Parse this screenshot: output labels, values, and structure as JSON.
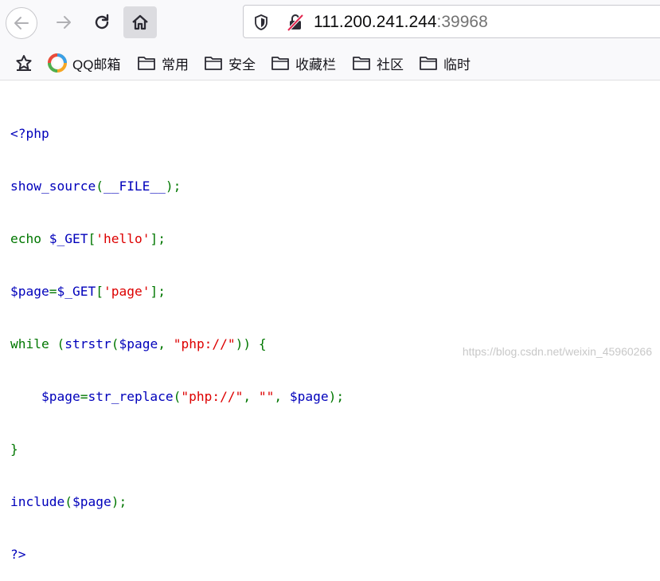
{
  "browser": {
    "url_host": "111.200.241.244",
    "url_port": ":39968"
  },
  "bookmarks": [
    {
      "label": "QQ邮箱",
      "icon": "qq-mail-icon"
    },
    {
      "label": "常用",
      "icon": "folder-icon"
    },
    {
      "label": "安全",
      "icon": "folder-icon"
    },
    {
      "label": "收藏栏",
      "icon": "folder-icon"
    },
    {
      "label": "社区",
      "icon": "folder-icon"
    },
    {
      "label": "临时",
      "icon": "folder-icon"
    }
  ],
  "code": {
    "l1": "<?php",
    "l2a": "show_source",
    "l2b": "(",
    "l2c": "__FILE__",
    "l2d": ");",
    "l3a": "echo ",
    "l3b": "$_GET",
    "l3c": "[",
    "l3d": "'hello'",
    "l3e": "];",
    "l4a": "$page",
    "l4b": "=",
    "l4c": "$_GET",
    "l4d": "[",
    "l4e": "'page'",
    "l4f": "];",
    "l5a": "while (",
    "l5b": "strstr",
    "l5c": "(",
    "l5d": "$page",
    "l5e": ", ",
    "l5f": "\"php://\"",
    "l5g": ")) {",
    "l6a": "    ",
    "l6b": "$page",
    "l6c": "=",
    "l6d": "str_replace",
    "l6e": "(",
    "l6f": "\"php://\"",
    "l6g": ", ",
    "l6h": "\"\"",
    "l6i": ", ",
    "l6j": "$page",
    "l6k": ");",
    "l7": "}",
    "l8a": "include",
    "l8b": "(",
    "l8c": "$page",
    "l8d": ");",
    "l9": "?>"
  },
  "watermark": "https://blog.csdn.net/weixin_45960266",
  "colors": {
    "php_default": "#0000BB",
    "php_keyword": "#007700",
    "php_string": "#DD0000"
  }
}
